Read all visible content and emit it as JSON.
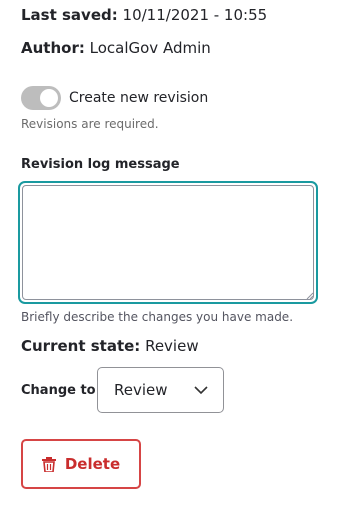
{
  "meta": {
    "last_saved_label": "Last saved:",
    "last_saved_value": "10/11/2021 - 10:55",
    "author_label": "Author:",
    "author_value": "LocalGov Admin"
  },
  "revision": {
    "toggle_on": true,
    "toggle_label": "Create new revision",
    "help": "Revisions are required."
  },
  "log": {
    "label": "Revision log message",
    "value": "",
    "help": "Briefly describe the changes you have made."
  },
  "moderation": {
    "current_state_label": "Current state:",
    "current_state_value": "Review",
    "change_to_label": "Change to:",
    "change_to_value": "Review"
  },
  "actions": {
    "delete_label": "Delete"
  },
  "colors": {
    "focus": "#1a9aa0",
    "danger": "#d64545"
  },
  "icons": {
    "trash": "trash-icon",
    "chevron": "chevron-down-icon"
  }
}
